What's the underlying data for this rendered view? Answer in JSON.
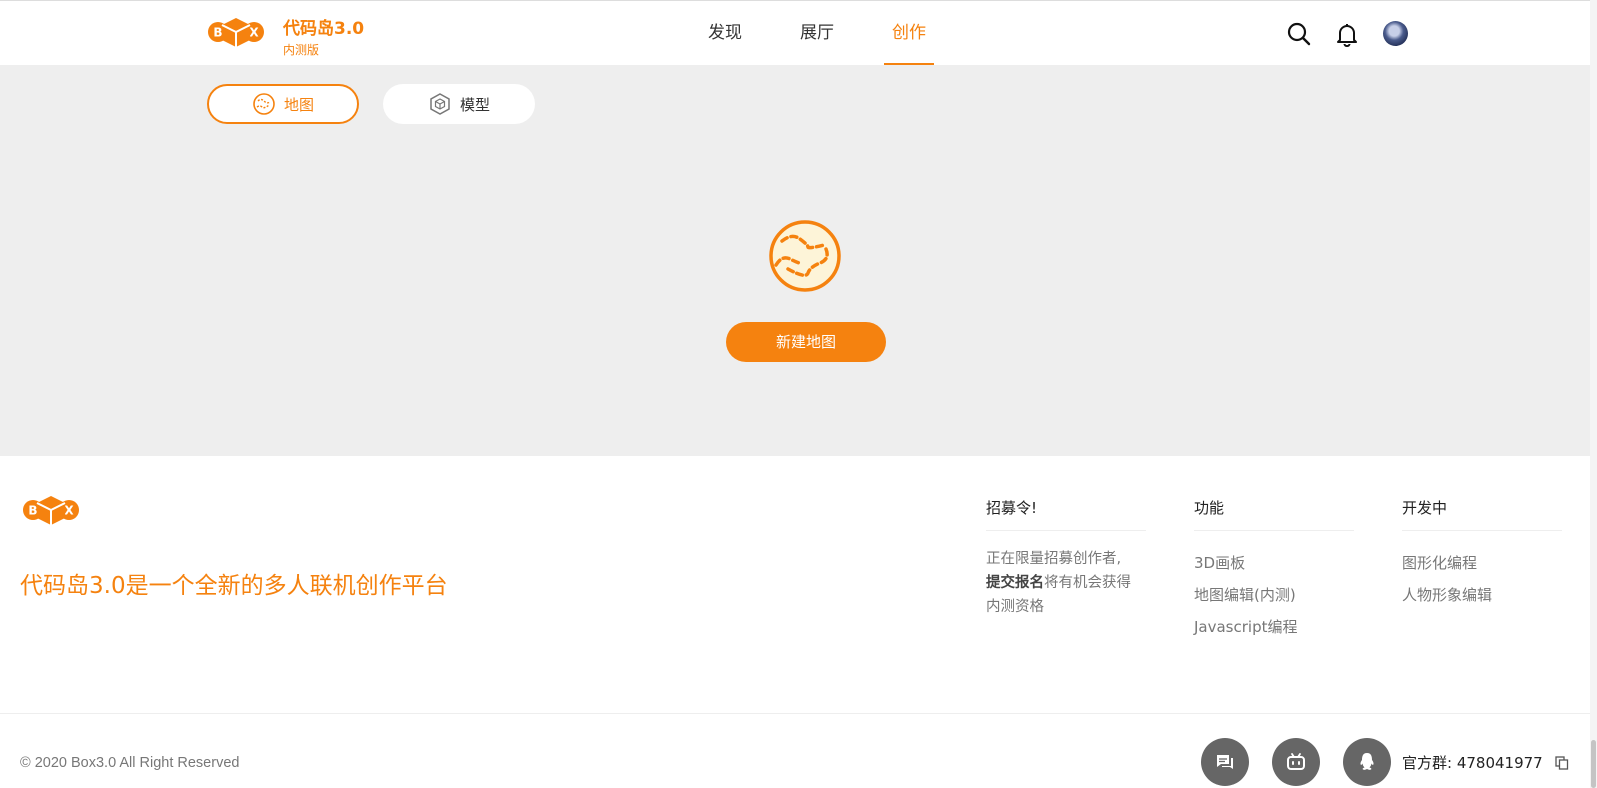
{
  "header": {
    "brand_title": "代码岛3.0",
    "brand_sub": "内测版",
    "nav": [
      {
        "label": "发现",
        "active": false
      },
      {
        "label": "展厅",
        "active": false
      },
      {
        "label": "创作",
        "active": true
      }
    ],
    "icons": [
      "search-icon",
      "bell-icon",
      "avatar"
    ]
  },
  "main": {
    "tabs": [
      {
        "label": "地图",
        "icon": "map-icon",
        "active": true
      },
      {
        "label": "模型",
        "icon": "cube-icon",
        "active": false
      }
    ],
    "new_map_label": "新建地图"
  },
  "footer": {
    "slogan": "代码岛3.0是一个全新的多人联机创作平台",
    "columns": {
      "recruit": {
        "title": "招募令!",
        "line1": "正在限量招募创作者,",
        "bold": "提交报名",
        "line2": "将有机会获得",
        "line3": "内测资格"
      },
      "features": {
        "title": "功能",
        "links": [
          "3D画板",
          "地图编辑(内测)",
          "Javascript编程"
        ]
      },
      "developing": {
        "title": "开发中",
        "links": [
          "图形化编程",
          "人物形象编辑"
        ]
      }
    },
    "copyright": "© 2020 Box3.0 All Right Reserved",
    "qq_group_label": "官方群: ",
    "qq_group_number": "478041977"
  },
  "colors": {
    "accent": "#f5820f",
    "main_bg": "#eeeeee",
    "social_bg": "#666666"
  }
}
